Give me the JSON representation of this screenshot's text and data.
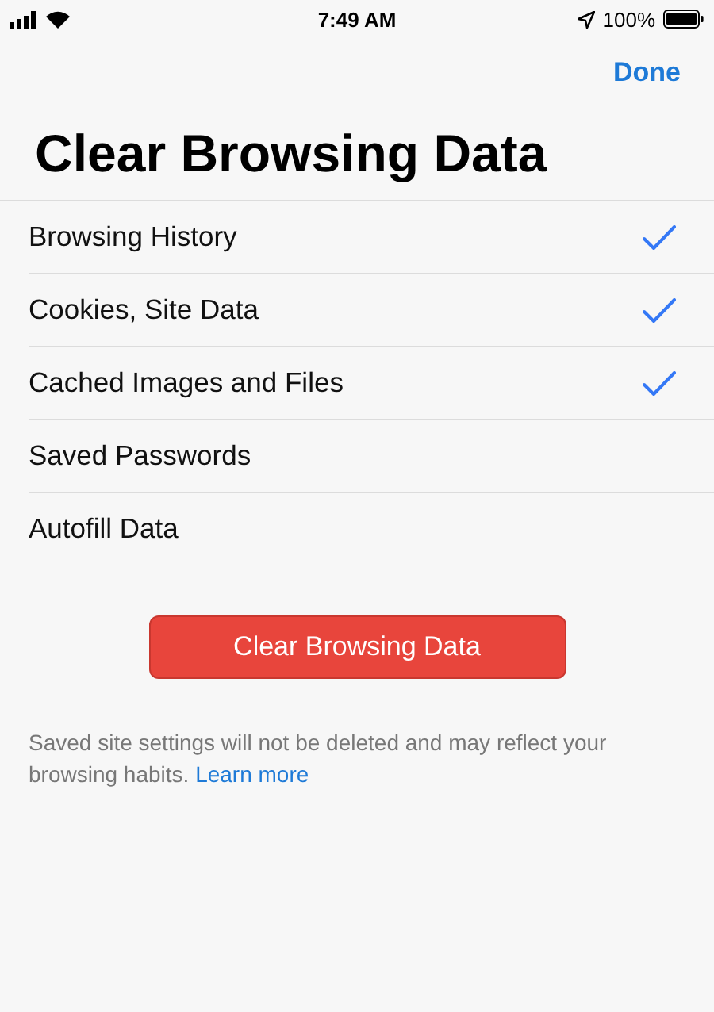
{
  "status_bar": {
    "time": "7:49 AM",
    "battery": "100%"
  },
  "nav": {
    "done": "Done"
  },
  "title": "Clear Browsing Data",
  "options": [
    {
      "label": "Browsing History",
      "checked": true
    },
    {
      "label": "Cookies, Site Data",
      "checked": true
    },
    {
      "label": "Cached Images and Files",
      "checked": true
    },
    {
      "label": "Saved Passwords",
      "checked": false
    },
    {
      "label": "Autofill Data",
      "checked": false
    }
  ],
  "clear_button": "Clear Browsing Data",
  "footer": {
    "text": "Saved site settings will not be deleted and may reflect your browsing habits.",
    "link": "Learn more"
  }
}
